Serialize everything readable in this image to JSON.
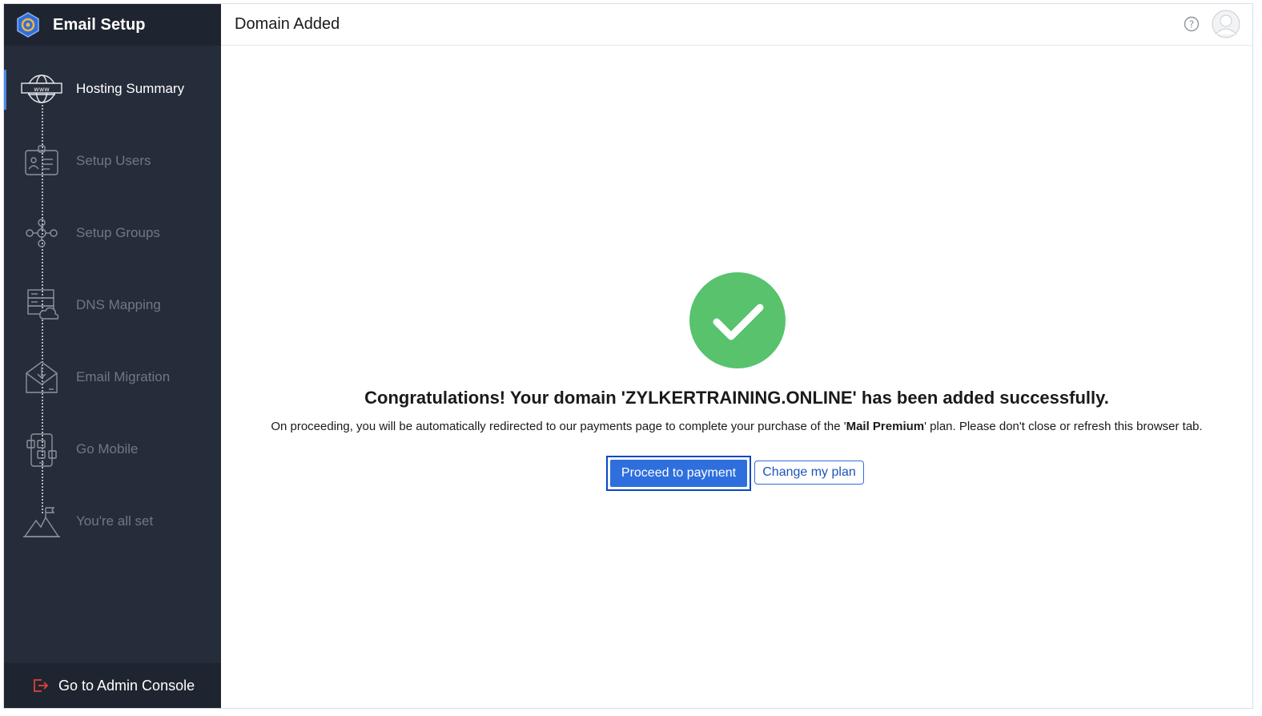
{
  "sidebar": {
    "title": "Email Setup",
    "steps": [
      {
        "label": "Hosting Summary",
        "icon": "globe-www-icon",
        "active": true
      },
      {
        "label": "Setup Users",
        "icon": "id-badge-icon",
        "active": false
      },
      {
        "label": "Setup Groups",
        "icon": "group-network-icon",
        "active": false
      },
      {
        "label": "DNS Mapping",
        "icon": "server-cloud-icon",
        "active": false
      },
      {
        "label": "Email Migration",
        "icon": "envelope-download-icon",
        "active": false
      },
      {
        "label": "Go Mobile",
        "icon": "mobile-apps-icon",
        "active": false
      },
      {
        "label": "You're all set",
        "icon": "mountain-flag-icon",
        "active": false
      }
    ],
    "admin_label": "Go to Admin Console"
  },
  "header": {
    "title": "Domain Added"
  },
  "main": {
    "headline": "Congratulations! Your domain 'ZYLKERTRAINING.ONLINE' has been added successfully.",
    "message_before": "On proceeding, you will be automatically redirected to our payments page to complete your purchase of the '",
    "plan_name": "Mail Premium",
    "message_after": "' plan. Please don't close or refresh this browser tab.",
    "primary_button": "Proceed to payment",
    "secondary_button": "Change my plan"
  },
  "colors": {
    "sidebar_bg": "#262d3a",
    "sidebar_header_bg": "#1f2530",
    "accent": "#2f6fdd",
    "success": "#58c26d",
    "admin_icon": "#e0413a"
  }
}
